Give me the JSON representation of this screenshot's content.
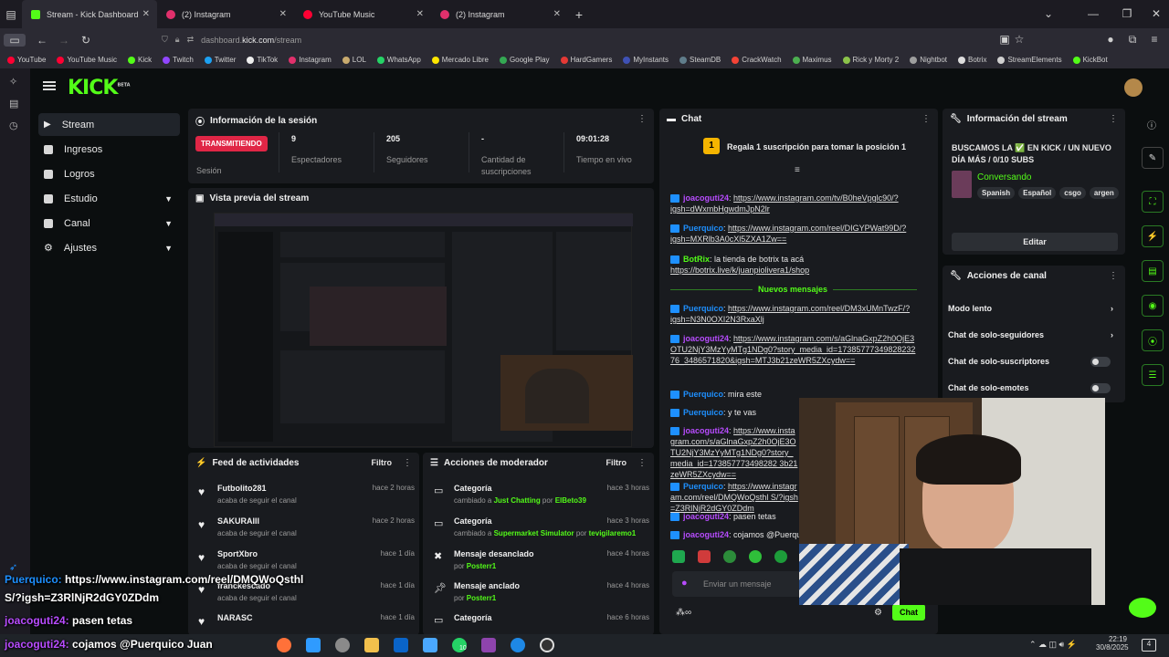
{
  "browser": {
    "tabs": [
      {
        "label": "Stream - Kick Dashboard",
        "color": "#53fc18",
        "active": true
      },
      {
        "label": "(2) Instagram",
        "color": "#e1306c",
        "active": false
      },
      {
        "label": "YouTube Music",
        "color": "#ff0033",
        "active": false
      },
      {
        "label": "(2) Instagram",
        "color": "#e1306c",
        "active": false
      }
    ],
    "url_prefix": "dashboard.",
    "url_domain": "kick.com",
    "url_path": "/stream",
    "bookmarks": [
      "YouTube",
      "YouTube Music",
      "Kick",
      "Twitch",
      "Twitter",
      "TikTok",
      "Instagram",
      "LOL",
      "WhatsApp",
      "Mercado Libre",
      "Google Play",
      "HardGamers",
      "MyInstants",
      "SteamDB",
      "CrackWatch",
      "Maximus",
      "Rick y Morty 2",
      "Nightbot",
      "Botrix",
      "StreamElements",
      "KickBot"
    ]
  },
  "sidebar": {
    "logo": "KICK",
    "logo_sup": "BETA",
    "items": [
      {
        "label": "Stream",
        "active": true
      },
      {
        "label": "Ingresos"
      },
      {
        "label": "Logros"
      },
      {
        "label": "Estudio",
        "chevron": true
      },
      {
        "label": "Canal",
        "chevron": true
      },
      {
        "label": "Ajustes",
        "chevron": true
      }
    ]
  },
  "session": {
    "title": "Información de la sesión",
    "live_badge": "TRANSMITIENDO",
    "live_label": "Sesión",
    "stats": [
      {
        "value": "9",
        "label": "Espectadores"
      },
      {
        "value": "205",
        "label": "Seguidores"
      },
      {
        "value": "-",
        "label": "Cantidad de suscripciones"
      },
      {
        "value": "09:01:28",
        "label": "Tiempo en vivo"
      }
    ]
  },
  "preview": {
    "title": "Vista previa del stream"
  },
  "feed": {
    "title": "Feed de actividades",
    "filter": "Filtro",
    "items": [
      {
        "name": "Futbolito281",
        "sub": "acaba de seguir el canal",
        "time": "hace 2 horas"
      },
      {
        "name": "SAKURAIII",
        "sub": "acaba de seguir el canal",
        "time": "hace 2 horas"
      },
      {
        "name": "SportXbro",
        "sub": "acaba de seguir el canal",
        "time": "hace 1 día"
      },
      {
        "name": "franckescado",
        "sub": "acaba de seguir el canal",
        "time": "hace 1 día"
      },
      {
        "name": "NARASC",
        "sub": "",
        "time": "hace 1 día"
      }
    ]
  },
  "mod": {
    "title": "Acciones de moderador",
    "filter": "Filtro",
    "items": [
      {
        "name": "Categoría",
        "pre": "cambiado a ",
        "hl": "Just Chatting",
        "mid": " por ",
        "by": "ElBeto39",
        "time": "hace 3 horas"
      },
      {
        "name": "Categoría",
        "pre": "cambiado a ",
        "hl": "Supermarket Simulator",
        "mid": " por ",
        "by": "tevigilaremo1",
        "time": "hace 3 horas"
      },
      {
        "name": "Mensaje desanclado",
        "pre": "por ",
        "hl": "",
        "mid": "",
        "by": "Posterr1",
        "time": "hace 4 horas"
      },
      {
        "name": "Mensaje anclado",
        "pre": "por ",
        "hl": "",
        "mid": "",
        "by": "Posterr1",
        "time": "hace 4 horas"
      },
      {
        "name": "Categoría",
        "pre": "",
        "hl": "",
        "mid": "",
        "by": "",
        "time": "hace 6 horas"
      }
    ]
  },
  "chat": {
    "title": "Chat",
    "pinned_rank": "1",
    "pinned_text": "Regala 1 suscripción para tomar la posición 1",
    "new_messages": "Nuevos mensajes",
    "input_placeholder": "Enviar un mensaje",
    "send_label": "Chat",
    "messages": [
      {
        "user": "joacoguti24",
        "color": "#b84cff",
        "text": "",
        "link": "https://www.instagram.com/tv/B0heVpglc90/?igsh=dWxmbHgwdmJpN2lr"
      },
      {
        "user": "Puerquico",
        "color": "#1e90ff",
        "text": "",
        "link": "https://www.instagram.com/reel/DIGYPWat99D/?igsh=MXRlb3A0cXl5ZXA1Zw=="
      },
      {
        "user": "BotRix",
        "color": "#53fc18",
        "text": "la tienda de botrix ta acá ",
        "link": "https://botrix.live/k/juanpiolivera1/shop"
      },
      {
        "user": "Puerquico",
        "color": "#1e90ff",
        "text": "",
        "link": "https://www.instagram.com/reel/DM3xUMnTwzF/?igsh=N3N0OXI2N3RxaXlj"
      },
      {
        "user": "joacoguti24",
        "color": "#b84cff",
        "text": "",
        "link": "https://www.instagram.com/s/aGlnaGxpZ2h0OjE3OTU2NjY3MzYyMTg1NDg0?story_media_id=1738577734982823276_3486571820&igsh=MTJ3b21zeWR5ZXcydw=="
      },
      {
        "user": "Puerquico",
        "color": "#1e90ff",
        "text": "mira este",
        "link": ""
      },
      {
        "user": "Puerquico",
        "color": "#1e90ff",
        "text": "y te vas",
        "link": ""
      },
      {
        "user": "joacoguti24",
        "color": "#b84cff",
        "text": "",
        "link": "https://www.instagram.com/s/aGlnaGxpZ2h0OjE3OTU2NjY3MzYyMTg1NDg0?story_media_id=173857773498282 3b21zeWR5ZXcydw=="
      },
      {
        "user": "Puerquico",
        "color": "#1e90ff",
        "text": "",
        "link": "https://www.instagram.com/reel/DMQWoQsthl S/?igsh=Z3RlNjR2dGY0ZDdm"
      },
      {
        "user": "joacoguti24",
        "color": "#b84cff",
        "text": "pasen tetas",
        "link": ""
      },
      {
        "user": "joacoguti24",
        "color": "#b84cff",
        "text": "cojamos @Puerquico",
        "link": ""
      }
    ]
  },
  "stream_info": {
    "title_header": "Información del stream",
    "stream_title": "BUSCAMOS LA ✅ EN KICK / UN NUEVO DÍA MÁS / 0/10 SUBS",
    "category": "Conversando",
    "tags": [
      "Spanish",
      "Español",
      "csgo",
      "argen"
    ],
    "edit": "Editar"
  },
  "channel_actions": {
    "title": "Acciones de canal",
    "items": [
      {
        "label": "Modo lento",
        "kind": "chevron"
      },
      {
        "label": "Chat de solo-seguidores",
        "kind": "chevron"
      },
      {
        "label": "Chat de solo-suscriptores",
        "kind": "toggle"
      },
      {
        "label": "Chat de solo-emotes",
        "kind": "toggle"
      }
    ]
  },
  "overlay": {
    "line1_user": "Puerquico:",
    "line1_text": " https://www.instagram.com/reel/DMQWoQsthl",
    "line2": "S/?igsh=Z3RlNjR2dGY0ZDdm",
    "line3_user": "joacoguti24:",
    "line3_text": " pasen tetas",
    "line4_user": "joacoguti24:",
    "line4_text": " cojamos @Puerquico Juan"
  },
  "taskbar": {
    "time": "22:19",
    "date": "30/8/2025",
    "notif_count": "4",
    "whatsapp_badge": "10"
  }
}
